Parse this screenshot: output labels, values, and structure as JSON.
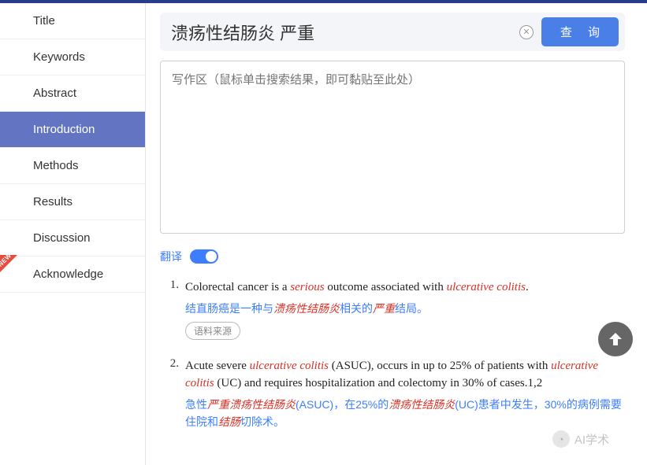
{
  "sidebar": {
    "items": [
      {
        "label": "Title"
      },
      {
        "label": "Keywords"
      },
      {
        "label": "Abstract"
      },
      {
        "label": "Introduction"
      },
      {
        "label": "Methods"
      },
      {
        "label": "Results"
      },
      {
        "label": "Discussion"
      },
      {
        "label": "Acknowledge"
      }
    ],
    "active_index": 3,
    "new_index": 7
  },
  "search": {
    "value": "溃疡性结肠炎 严重",
    "query_label": "查 询"
  },
  "write_area": {
    "placeholder": "写作区（鼠标单击搜索结果，即可黏贴至此处）"
  },
  "translate": {
    "label": "翻译",
    "enabled": true
  },
  "results": [
    {
      "num": "1.",
      "en_parts": [
        {
          "t": "Colorectal cancer is a ",
          "hl": false
        },
        {
          "t": "serious",
          "hl": true
        },
        {
          "t": " outcome associated with ",
          "hl": false
        },
        {
          "t": "ulcerative colitis",
          "hl": true
        },
        {
          "t": ".",
          "hl": false
        }
      ],
      "cn_parts": [
        {
          "t": "结直肠癌是一种与",
          "hl": false
        },
        {
          "t": "溃疡性结肠炎",
          "hl": true
        },
        {
          "t": "相关的",
          "hl": false
        },
        {
          "t": "严重",
          "hl": true
        },
        {
          "t": "结局。",
          "hl": false
        }
      ],
      "source_label": "语料来源"
    },
    {
      "num": "2.",
      "en_parts": [
        {
          "t": "Acute severe ",
          "hl": false
        },
        {
          "t": "ulcerative colitis",
          "hl": true
        },
        {
          "t": " (ASUC), occurs in up to 25% of patients with ",
          "hl": false
        },
        {
          "t": "ulcerative colitis",
          "hl": true
        },
        {
          "t": " (UC) and requires hospitalization and colectomy in 30% of cases.1,2",
          "hl": false
        }
      ],
      "cn_parts": [
        {
          "t": "急性",
          "hl": false
        },
        {
          "t": "严重溃疡性结肠炎",
          "hl": true
        },
        {
          "t": "(ASUC)，在25%的",
          "hl": false
        },
        {
          "t": "溃疡性结肠炎",
          "hl": true
        },
        {
          "t": "(UC)患者中发生，30%的病例需要住院和",
          "hl": false
        },
        {
          "t": "结肠",
          "hl": true
        },
        {
          "t": "切除术。",
          "hl": false
        }
      ]
    }
  ],
  "watermark": {
    "text": "AI学术"
  }
}
